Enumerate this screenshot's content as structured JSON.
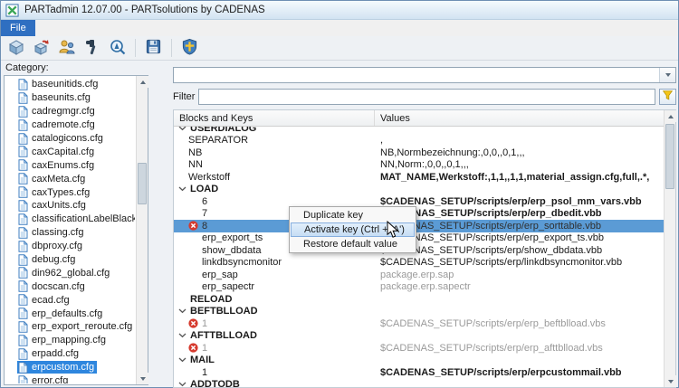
{
  "window": {
    "title": "PARTadmin 12.07.00 - PARTsolutions by CADENAS"
  },
  "menubar": {
    "file_label": "File"
  },
  "toolbar": {
    "buttons": [
      {
        "icon": "catalog-icon"
      },
      {
        "icon": "update-icon"
      },
      {
        "icon": "user-management-icon"
      },
      {
        "icon": "tools-icon"
      },
      {
        "icon": "search-icon"
      },
      {
        "sep": true
      },
      {
        "icon": "save-icon"
      },
      {
        "sep": true
      },
      {
        "icon": "shield-icon"
      }
    ]
  },
  "sidebar": {
    "label": "Category:",
    "selected": "erpcustom.cfg",
    "items": [
      "baseunitids.cfg",
      "baseunits.cfg",
      "cadregmgr.cfg",
      "cadremote.cfg",
      "catalogicons.cfg",
      "caxCapital.cfg",
      "caxEnums.cfg",
      "caxMeta.cfg",
      "caxTypes.cfg",
      "caxUnits.cfg",
      "classificationLabelBlackl",
      "classing.cfg",
      "dbproxy.cfg",
      "debug.cfg",
      "din962_global.cfg",
      "docscan.cfg",
      "ecad.cfg",
      "erp_defaults.cfg",
      "erp_export_reroute.cfg",
      "erp_mapping.cfg",
      "erpadd.cfg",
      "erpcustom.cfg",
      "error.cfg"
    ]
  },
  "right_panel": {
    "combobox_value": "",
    "filter_label": "Filter",
    "filter_value": ""
  },
  "table": {
    "columns": [
      "Blocks and Keys",
      "Values"
    ],
    "rows": [
      {
        "kind": "group",
        "label": "USERDIALOG",
        "chevron": true,
        "partial": true
      },
      {
        "kind": "item",
        "indent": 1,
        "key": "SEPARATOR",
        "value": ","
      },
      {
        "kind": "item",
        "indent": 1,
        "key": "NB",
        "value": "NB,Normbezeichnung:,0,0,,0,1,,,"
      },
      {
        "kind": "item",
        "indent": 1,
        "key": "NN",
        "value": "NN,Norm:,0,0,,0,1,,,"
      },
      {
        "kind": "item",
        "indent": 1,
        "key": "Werkstoff",
        "value": "MAT_NAME,Werkstoff:,1,1,,1,1,material_assign.cfg,full,.*,",
        "bold_value": true
      },
      {
        "kind": "group",
        "label": "LOAD",
        "chevron": true
      },
      {
        "kind": "item",
        "indent": 2,
        "key": "6",
        "value": "$CADENAS_SETUP/scripts/erp/erp_psol_mm_vars.vbb",
        "bold_value": true
      },
      {
        "kind": "item",
        "indent": 2,
        "key": "7",
        "value": "$CADENAS_SETUP/scripts/erp/erp_dbedit.vbb",
        "bold_value": true
      },
      {
        "kind": "item",
        "indent": 2,
        "key": "8",
        "icon": "deactivated",
        "value": "$CADENAS_SETUP/scripts/erp/erp_sorttable.vbb",
        "gray": true,
        "selected": true
      },
      {
        "kind": "item",
        "indent": 2,
        "key": "erp_export_ts",
        "value": "$CADENAS_SETUP/scripts/erp/erp_export_ts.vbb"
      },
      {
        "kind": "item",
        "indent": 2,
        "key": "show_dbdata",
        "value": "$CADENAS_SETUP/scripts/erp/show_dbdata.vbb"
      },
      {
        "kind": "item",
        "indent": 2,
        "key": "linkdbsyncmonitor",
        "value": "$CADENAS_SETUP/scripts/erp/linkdbsyncmonitor.vbb"
      },
      {
        "kind": "item",
        "indent": 2,
        "key": "erp_sap",
        "value": "package.erp.sap",
        "gray_value": true
      },
      {
        "kind": "item",
        "indent": 2,
        "key": "erp_sapectr",
        "value": "package.erp.sapectr",
        "gray_value": true
      },
      {
        "kind": "group",
        "label": "RELOAD",
        "chevron": false
      },
      {
        "kind": "group",
        "label": "BEFTBLLOAD",
        "chevron": true
      },
      {
        "kind": "item",
        "indent": 2,
        "key": "1",
        "icon": "deactivated",
        "value": "$CADENAS_SETUP/scripts/erp/erp_beftblload.vbs",
        "gray": true
      },
      {
        "kind": "group",
        "label": "AFTTBLLOAD",
        "chevron": true
      },
      {
        "kind": "item",
        "indent": 2,
        "key": "1",
        "icon": "deactivated",
        "value": "$CADENAS_SETUP/scripts/erp/erp_afttblload.vbs",
        "gray": true
      },
      {
        "kind": "group",
        "label": "MAIL",
        "chevron": true
      },
      {
        "kind": "item",
        "indent": 2,
        "key": "1",
        "value": "$CADENAS_SETUP/scripts/erp/erpcustommail.vbb",
        "bold_value": true
      },
      {
        "kind": "group",
        "label": "ADDTODB",
        "chevron": true
      }
    ]
  },
  "context_menu": {
    "items": [
      {
        "label": "Duplicate key"
      },
      {
        "label": "Activate key (Ctrl + 'A')",
        "highlighted": true
      },
      {
        "label": "Restore default value"
      }
    ]
  },
  "colors": {
    "tree_selection": "#2e86de",
    "row_selection": "#5b9bd5",
    "deactivated_red": "#d63a2e",
    "menu_item_highlight": "#c6ddf4",
    "file_menu_blue": "#2f6fc1"
  }
}
